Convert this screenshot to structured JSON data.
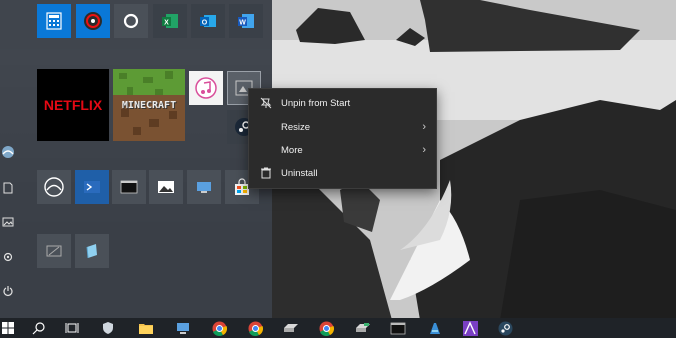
{
  "start_menu": {
    "tiles": {
      "netflix_label": "NETFLIX",
      "minecraft_label": "MINECRAFT"
    }
  },
  "context_menu": {
    "items": [
      {
        "label": "Unpin from Start",
        "icon": "unpin-icon",
        "submenu": false
      },
      {
        "label": "Resize",
        "icon": "",
        "submenu": true
      },
      {
        "label": "More",
        "icon": "",
        "submenu": true
      },
      {
        "label": "Uninstall",
        "icon": "trash-icon",
        "submenu": false
      }
    ]
  },
  "colors": {
    "start_bg": "#3a4048",
    "context_bg": "#2b2b2b",
    "taskbar_bg": "#1f2328",
    "accent": "#0a78d7",
    "netflix_red": "#e50914"
  }
}
